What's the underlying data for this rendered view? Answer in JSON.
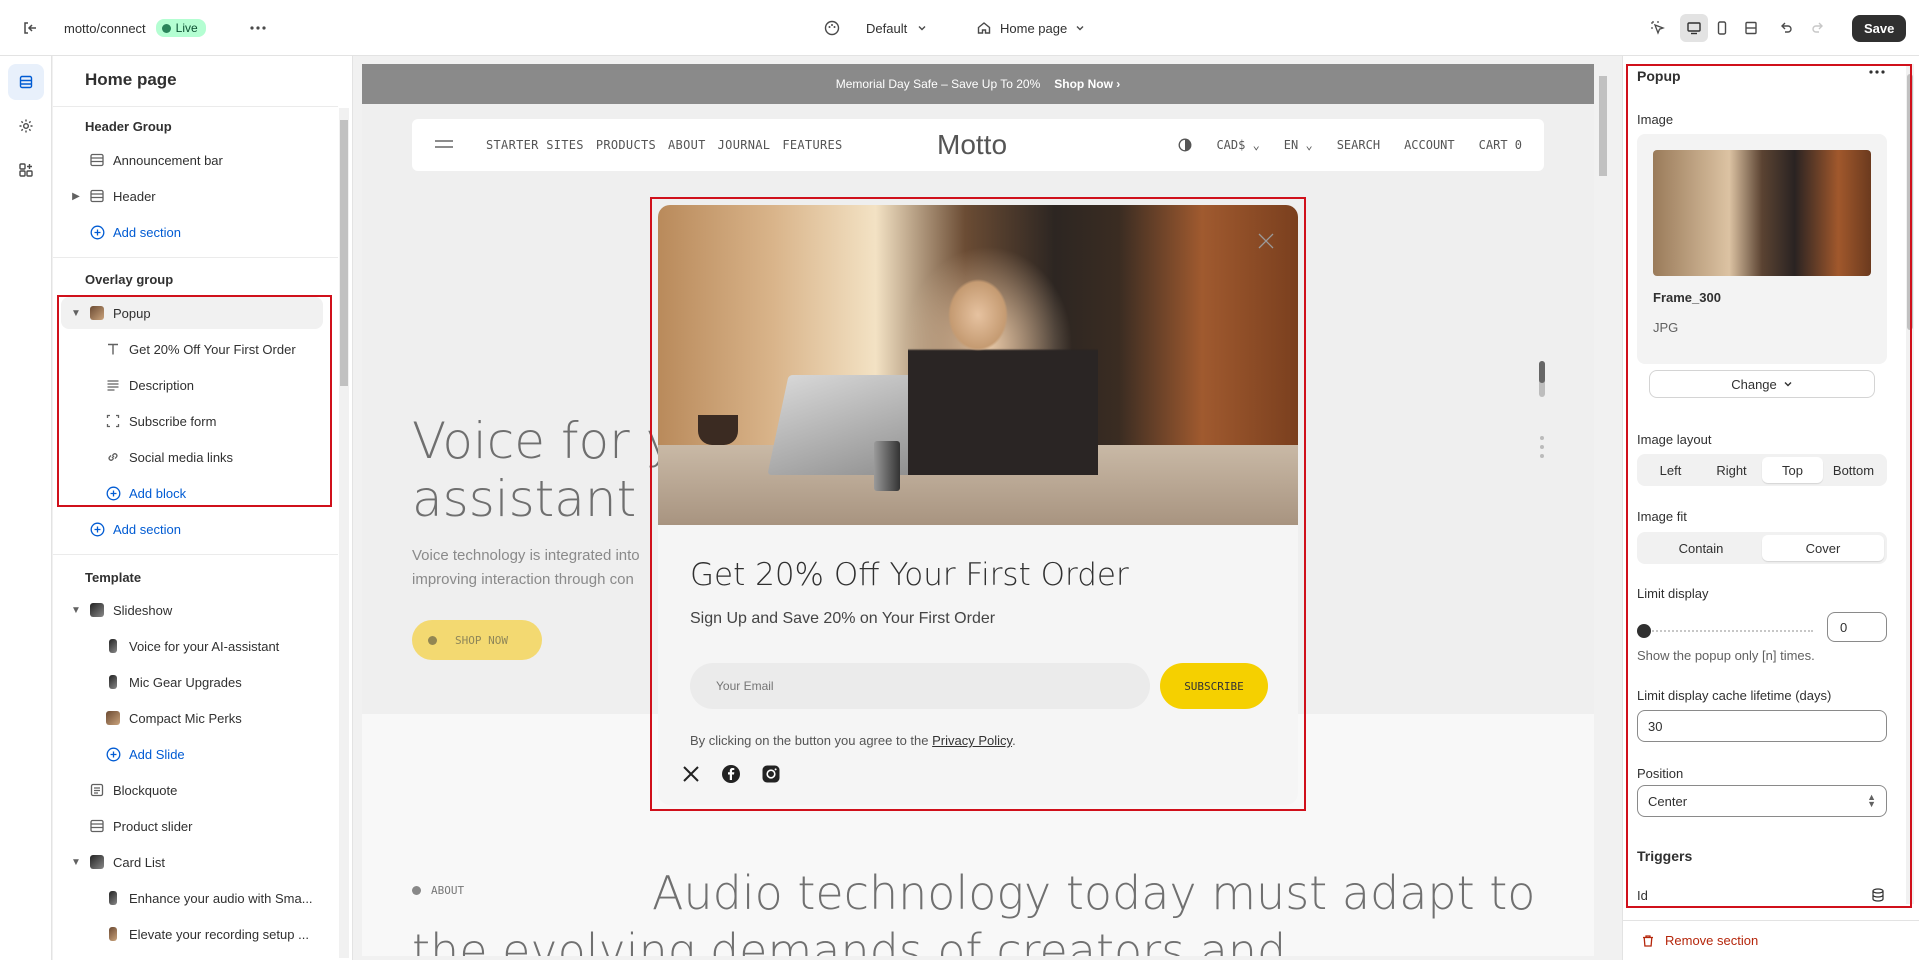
{
  "topbar": {
    "store": "motto/connect",
    "live": "Live",
    "theme": "Default",
    "page": "Home page",
    "save": "Save"
  },
  "sidebar": {
    "title": "Home page",
    "header_group": "Header Group",
    "announcement_bar": "Announcement bar",
    "header": "Header",
    "add_section": "Add section",
    "overlay_group": "Overlay group",
    "popup": "Popup",
    "popup_blocks": [
      "Get 20% Off Your First Order",
      "Description",
      "Subscribe form",
      "Social media links"
    ],
    "add_block": "Add block",
    "template": "Template",
    "slideshow": "Slideshow",
    "slides": [
      "Voice for your AI-assistant",
      "Mic Gear Upgrades",
      "Compact Mic Perks"
    ],
    "add_slide": "Add Slide",
    "blockquote": "Blockquote",
    "product_slider": "Product slider",
    "card_list": "Card List",
    "cards": [
      "Enhance your audio with Sma...",
      "Elevate your recording setup ..."
    ]
  },
  "canvas": {
    "announcement": "Memorial Day Safe – Save Up To 20%",
    "announcement_link": "Shop Now",
    "nav_links": [
      "STARTER SITES",
      "PRODUCTS",
      "ABOUT",
      "JOURNAL",
      "FEATURES"
    ],
    "logo": "Motto",
    "currency": "CAD$",
    "language": "EN",
    "search": "SEARCH",
    "account": "ACCOUNT",
    "cart": "CART 0",
    "hero_title_1": "Voice for y",
    "hero_title_2": "assistant",
    "hero_desc_1": "Voice technology is integrated into",
    "hero_desc_2": "improving interaction through con",
    "shop_now": "SHOP NOW",
    "about_label": "ABOUT",
    "about_text": "Audio technology today must adapt to the evolving demands of creators and"
  },
  "popup": {
    "title": "Get 20% Off Your First Order",
    "subtitle": "Sign Up and Save 20% on Your First Order",
    "email_placeholder": "Your Email",
    "subscribe": "SUBSCRIBE",
    "legal_prefix": "By clicking on the button you agree to the ",
    "legal_link": "Privacy Policy",
    "legal_suffix": "."
  },
  "rpanel": {
    "title": "Popup",
    "image_label": "Image",
    "image_name": "Frame_300",
    "image_type": "JPG",
    "change": "Change",
    "image_layout_label": "Image layout",
    "image_layout_options": [
      "Left",
      "Right",
      "Top",
      "Bottom"
    ],
    "image_layout_selected": "Top",
    "image_fit_label": "Image fit",
    "image_fit_options": [
      "Contain",
      "Cover"
    ],
    "image_fit_selected": "Cover",
    "limit_display_label": "Limit display",
    "limit_display_value": "0",
    "limit_display_help": "Show the popup only [n] times.",
    "cache_label": "Limit display cache lifetime (days)",
    "cache_value": "30",
    "position_label": "Position",
    "position_value": "Center",
    "triggers_label": "Triggers",
    "id_label": "Id",
    "remove_section": "Remove section"
  },
  "colors": {
    "accent_blue": "#005bd3",
    "highlight_red": "#d0101b",
    "live_green": "#b4fed2",
    "popup_yellow": "#f5d000",
    "danger": "#b5260b"
  }
}
